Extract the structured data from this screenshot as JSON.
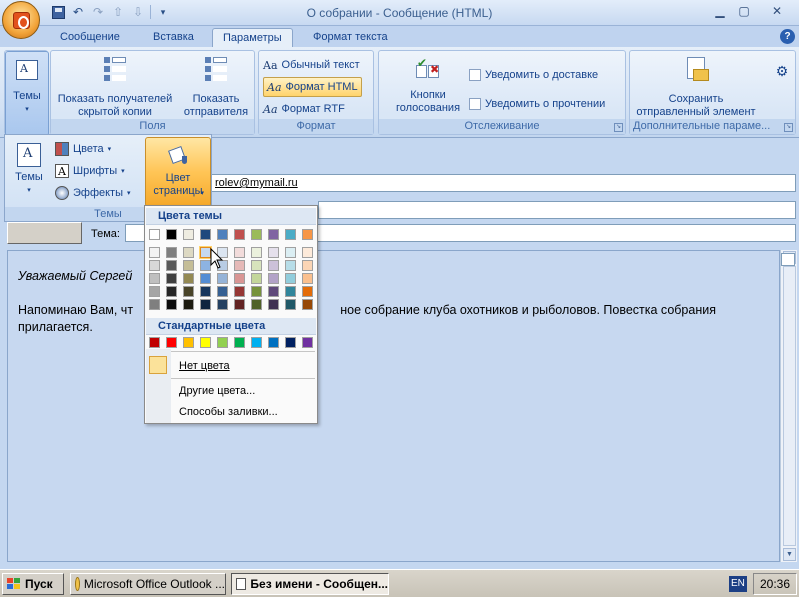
{
  "window": {
    "title": "О собрании - Сообщение (HTML)"
  },
  "ribbon_tabs": [
    "Сообщение",
    "Вставка",
    "Параметры",
    "Формат текста"
  ],
  "groups": {
    "themes": {
      "label": "Темы",
      "big_button": "Темы"
    },
    "fields": {
      "label": "Поля",
      "show_bcc": "Показать получателей скрытой копии",
      "show_from": "Показать отправителя"
    },
    "format": {
      "label": "Формат",
      "plain": "Обычный текст",
      "html": "Формат HTML",
      "rtf": "Формат RTF"
    },
    "tracking": {
      "label": "Отслеживание",
      "voting": "Кнопки голосования",
      "delivery": "Уведомить о доставке",
      "read": "Уведомить о прочтении"
    },
    "more": {
      "label": "Дополнительные параме...",
      "save_sent": "Сохранить отправленный элемент"
    }
  },
  "themes_panel": {
    "colors": "Цвета",
    "fonts": "Шрифты",
    "effects": "Эффекты",
    "themes_btn": "Темы",
    "page_color": "Цвет страницы",
    "group_label": "Темы"
  },
  "form": {
    "to_value": "rolev@mymail.ru",
    "subject_label": "Тема:"
  },
  "body": {
    "greeting": "Уважаемый Сергей",
    "line1_left": "Напоминаю  Вам, чт",
    "line1_right": "ное собрание клуба охотников и рыболовов. Повестка собрания",
    "line2": "прилагается."
  },
  "color_menu": {
    "theme_colors_header": "Цвета темы",
    "standard_colors_header": "Стандартные цвета",
    "no_color": "Нет цвета",
    "more_colors": "Другие цвета...",
    "fill_effects": "Способы заливки...",
    "theme_top": [
      "#ffffff",
      "#000000",
      "#eeece1",
      "#1f497d",
      "#4f81bd",
      "#c0504d",
      "#9bbb59",
      "#8064a2",
      "#4bacc6",
      "#f79646"
    ],
    "theme_shades": [
      [
        "#f2f2f2",
        "#d8d8d8",
        "#bfbfbf",
        "#a5a5a5",
        "#7f7f7f"
      ],
      [
        "#7f7f7f",
        "#595959",
        "#3f3f3f",
        "#262626",
        "#0c0c0c"
      ],
      [
        "#ddd9c3",
        "#c4bd97",
        "#938953",
        "#494429",
        "#1d1b10"
      ],
      [
        "#c6d9f0",
        "#8db3e2",
        "#548dd4",
        "#17365d",
        "#0f243e"
      ],
      [
        "#dbe5f1",
        "#b8cce4",
        "#95b3d7",
        "#366092",
        "#244061"
      ],
      [
        "#f2dcdb",
        "#e5b9b7",
        "#d99694",
        "#953734",
        "#632423"
      ],
      [
        "#ebf1dd",
        "#d7e3bc",
        "#c3d69b",
        "#76923c",
        "#4f6128"
      ],
      [
        "#e5e0ec",
        "#ccc1d9",
        "#b2a2c7",
        "#5f497a",
        "#3f3151"
      ],
      [
        "#dbeef3",
        "#b7dde8",
        "#92cddc",
        "#31859b",
        "#205867"
      ],
      [
        "#fdeada",
        "#fbd5b5",
        "#fac08f",
        "#e36c09",
        "#974806"
      ]
    ],
    "standard": [
      "#c00000",
      "#ff0000",
      "#ffc000",
      "#ffff00",
      "#92d050",
      "#00b050",
      "#00b0f0",
      "#0070c0",
      "#002060",
      "#7030a0"
    ]
  },
  "taskbar": {
    "start": "Пуск",
    "task1": "Microsoft Office Outlook ...",
    "task2": "Без имени - Сообщен...",
    "lang": "EN",
    "time": "20:36"
  }
}
